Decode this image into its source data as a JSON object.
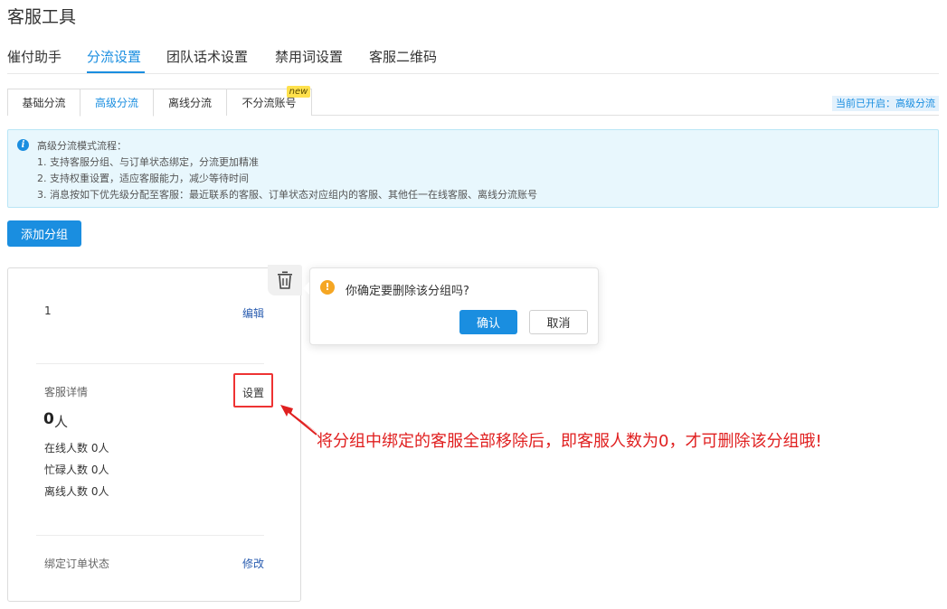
{
  "page_title": "客服工具",
  "main_tabs": [
    {
      "label": "催付助手"
    },
    {
      "label": "分流设置",
      "active": true
    },
    {
      "label": "团队话术设置"
    },
    {
      "label": "禁用词设置"
    },
    {
      "label": "客服二维码"
    }
  ],
  "sub_tabs": [
    {
      "label": "基础分流"
    },
    {
      "label": "高级分流",
      "active": true
    },
    {
      "label": "离线分流"
    },
    {
      "label": "不分流账号",
      "badge": "new"
    }
  ],
  "current_mode": "当前已开启：高级分流",
  "info": {
    "icon": "info-icon",
    "title": "高级分流模式流程：",
    "lines": [
      "1. 支持客服分组、与订单状态绑定，分流更加精准",
      "2. 支持权重设置，适应客服能力，减少等待时间",
      "3. 消息按如下优先级分配至客服：最近联系的客服、订单状态对应组内的客服、其他任一在线客服、离线分流账号"
    ]
  },
  "add_group_label": "添加分组",
  "group_card": {
    "name": "1",
    "edit_label": "编辑",
    "service_detail_label": "客服详情",
    "settings_label": "设置",
    "count": "0",
    "count_unit": "人",
    "online": "在线人数 0人",
    "busy": "忙碌人数 0人",
    "offline": "离线人数 0人",
    "bind_status_label": "绑定订单状态",
    "modify_label": "修改",
    "delete_icon": "trash-icon"
  },
  "popover": {
    "icon": "warning-icon",
    "message": "你确定要删除该分组吗?",
    "confirm_label": "确认",
    "cancel_label": "取消"
  },
  "annotation": "将分组中绑定的客服全部移除后，即客服人数为0，才可删除该分组哦!",
  "colors": {
    "accent": "#1a8ee0",
    "annotation": "#e02020",
    "warning": "#f5a623",
    "info_bg": "#e8f7fd"
  }
}
